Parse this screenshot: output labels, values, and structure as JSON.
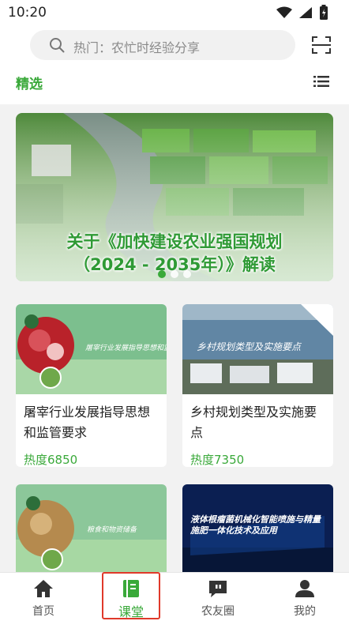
{
  "status": {
    "time": "10:20"
  },
  "search": {
    "placeholder": "热门：农忙时经验分享"
  },
  "tabs": {
    "selected": "精选"
  },
  "banner": {
    "title_line1": "关于《加快建设农业强国规划",
    "title_line2": "（2024 - 2035年）》解读",
    "page_count": 3,
    "active_index": 0
  },
  "courses": [
    {
      "title": "屠宰行业发展指导思想和监管要求",
      "heat": "热度6850",
      "thumb_caption": "屠宰行业发展指导思想和监管要求"
    },
    {
      "title": "乡村规划类型及实施要点",
      "heat": "热度7350",
      "thumb_caption": "乡村规划类型及实施要点"
    },
    {
      "title": "",
      "heat": "",
      "thumb_caption": "粮食和物资储备"
    },
    {
      "title": "",
      "heat": "",
      "thumb_caption": "液体根瘤菌机械化智能喷施与精量施肥一体化技术及应用"
    }
  ],
  "nav": {
    "home": "首页",
    "classroom": "课堂",
    "friends": "农友圈",
    "me": "我的",
    "active": "classroom"
  },
  "colors": {
    "accent": "#3aa93a",
    "highlight": "#e0392a"
  }
}
